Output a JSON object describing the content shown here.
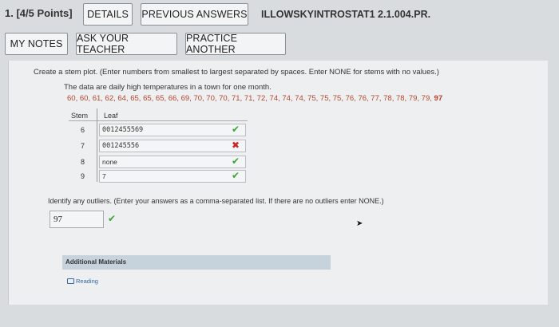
{
  "question": {
    "number": "1.",
    "points": "[4/5 Points]",
    "code": "ILLOWSKYINTROSTAT1 2.1.004.PR."
  },
  "toolbar": {
    "details": "DETAILS",
    "previous_answers": "PREVIOUS ANSWERS",
    "my_notes": "MY NOTES",
    "ask_teacher": "ASK YOUR TEACHER",
    "practice_another": "PRACTICE ANOTHER"
  },
  "prompt": {
    "instruction": "Create a stem plot. (Enter numbers from smallest to largest separated by spaces. Enter NONE for stems with no values.)",
    "description": "The data are daily high temperatures in a town for one month.",
    "values_text": "60, 60, 61, 62, 64, 65, 65, 65, 66, 69, 70, 70, 70, 71, 71, 72, 74, 74, 74, 75, 75, 75, 76, 76, 77, 78, 78, 79, 79,",
    "values_last": "97"
  },
  "stemplot": {
    "stem_header": "Stem",
    "leaf_header": "Leaf",
    "rows": [
      {
        "stem": "6",
        "leaf": "0012455569",
        "status": "correct"
      },
      {
        "stem": "7",
        "leaf": "001245556",
        "status": "incorrect"
      },
      {
        "stem": "8",
        "leaf": "none",
        "status": "correct"
      },
      {
        "stem": "9",
        "leaf": "7",
        "status": "correct"
      }
    ]
  },
  "outliers": {
    "instruction": "Identify any outliers. (Enter your answers as a comma-separated list. If there are no outliers enter NONE.)",
    "answer": "97",
    "status": "correct"
  },
  "additional": {
    "title": "Additional Materials",
    "reading": "Reading"
  },
  "colors": {
    "correct": "#3aa33a",
    "incorrect": "#c62828",
    "data_values": "#b4462a"
  }
}
